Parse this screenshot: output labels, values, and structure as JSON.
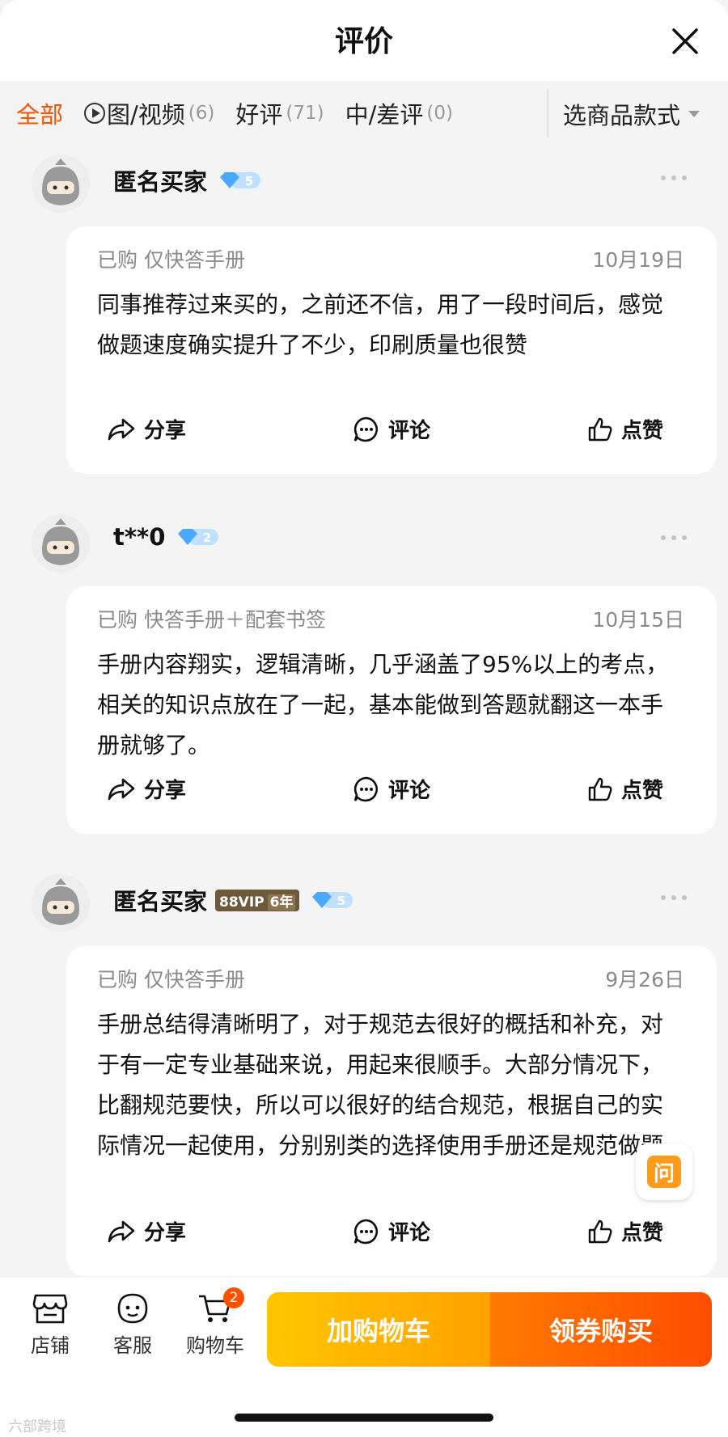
{
  "header": {
    "title": "评价"
  },
  "filters": {
    "all": "全部",
    "media": "图/视频",
    "media_count": "(6)",
    "good": "好评",
    "good_count": "(71)",
    "bad": "中/差评",
    "bad_count": "(0)",
    "style_select": "选商品款式"
  },
  "reviews": [
    {
      "user": "匿名买家",
      "level": "5",
      "purchased": "已购 仅快答手册",
      "date": "10月19日",
      "text": "同事推荐过来买的，之前还不信，用了一段时间后，感觉做题速度确实提升了不少，印刷质量也很赞",
      "share": "分享",
      "comment": "评论",
      "like": "点赞"
    },
    {
      "user": "t**0",
      "level": "2",
      "purchased": "已购 快答手册＋配套书签",
      "date": "10月15日",
      "text": "手册内容翔实，逻辑清晰，几乎涵盖了95%以上的考点，相关的知识点放在了一起，基本能做到答题就翻这一本手册就够了。",
      "share": "分享",
      "comment": "评论",
      "like": "点赞"
    },
    {
      "user": "匿名买家",
      "vip": "88VIP",
      "vip_years": "6年",
      "level": "5",
      "purchased": "已购 仅快答手册",
      "date": "9月26日",
      "text": "手册总结得清晰明了，对于规范去很好的概括和补充，对于有一定专业基础来说，用起来很顺手。大部分情况下，比翻规范要快，所以可以很好的结合规范，根据自己的实际情况一起使用，分别别类的选择使用手册还是规范做题",
      "share": "分享",
      "comment": "评论",
      "like": "点赞"
    }
  ],
  "ask_button": "问",
  "bottom": {
    "shop": "店铺",
    "service": "客服",
    "cart": "购物车",
    "cart_count": "2",
    "add_to_cart": "加购物车",
    "buy": "领券购买"
  },
  "watermark": "六部跨境",
  "colors": {
    "accent": "#ff5000",
    "cart_btn": "#ffb300",
    "buy_btn": "#ff5a00",
    "diamond": "#5ab4ff"
  }
}
